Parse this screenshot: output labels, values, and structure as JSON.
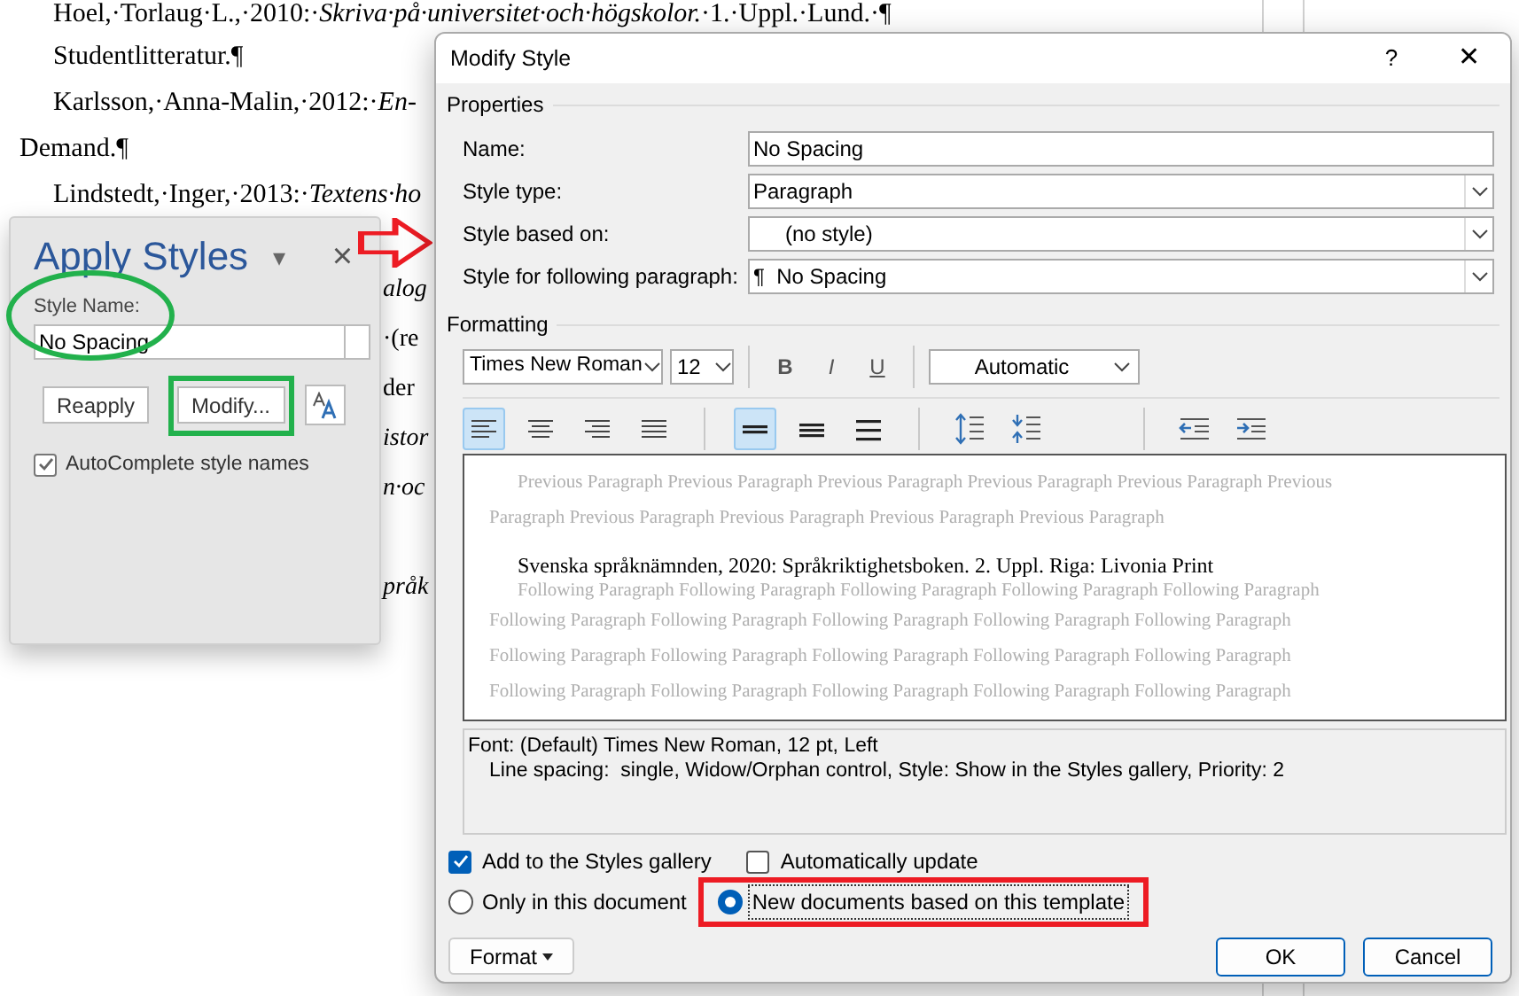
{
  "document": {
    "lines": [
      {
        "text": "Hoel,·Torlaug·L.,·2010:·*Skriva·på·universitet·och·högskolor.*·1.·Uppl.·Lund.·¶",
        "kind": "indented"
      },
      {
        "text": "Studentlitteratur.¶",
        "kind": "indented"
      },
      {
        "text": "Karlsson,·Anna-Malin,·2012:·*En-*",
        "kind": "indented"
      },
      {
        "text": "Demand.¶",
        "kind": "flush"
      },
      {
        "text": "Lindstedt,·Inger,·2013:·*Textens·ho*",
        "kind": "indented"
      },
      {
        "kind": "blank"
      },
      {
        "text": "*alog*",
        "kind": "fragment"
      },
      {
        "text": "·(re",
        "kind": "fragment"
      },
      {
        "text": "der",
        "kind": "fragment"
      },
      {
        "text": "*istor*",
        "kind": "fragment"
      },
      {
        "text": "*n·oc*",
        "kind": "fragment"
      },
      {
        "kind": "blank"
      },
      {
        "text": "*pråk*",
        "kind": "fragment"
      }
    ]
  },
  "apply_styles": {
    "title": "Apply Styles",
    "menu": "▾",
    "close": "×",
    "style_name_label": "Style Name:",
    "style_name_value": "No Spacing",
    "buttons": [
      {
        "label": "Reapply",
        "highlighted": false
      },
      {
        "label": "Modify...",
        "highlighted": true
      }
    ],
    "autocomplete": {
      "label": "AutoComplete style names",
      "checked": true
    }
  },
  "dialog": {
    "title": "Modify Style",
    "help": "?",
    "close": "✕",
    "properties": {
      "heading": "Properties",
      "fields": [
        {
          "label": "Name:",
          "value": "No Spacing",
          "kind": "text"
        },
        {
          "label": "Style type:",
          "value": "Paragraph",
          "kind": "dropdown"
        },
        {
          "label": "Style based on:",
          "value": "(no style)",
          "kind": "dropdown"
        },
        {
          "label": "Style for following paragraph:",
          "value": "¶  No Spacing",
          "kind": "dropdown"
        }
      ]
    },
    "formatting": {
      "heading": "Formatting",
      "font": "Times New Roman",
      "size": "12",
      "bold": "B",
      "italic": "I",
      "underline": "U",
      "font_colour": "Automatic",
      "alignment": [
        {
          "kind": "left",
          "selected": true
        },
        {
          "kind": "center",
          "selected": false
        },
        {
          "kind": "right",
          "selected": false
        },
        {
          "kind": "justify",
          "selected": false
        }
      ],
      "spacing": [
        {
          "kind": "single",
          "selected": true
        },
        {
          "kind": "onehalf",
          "selected": false
        },
        {
          "kind": "double",
          "selected": false
        }
      ],
      "paragraph_spacing": [
        {
          "kind": "increase"
        },
        {
          "kind": "decrease"
        }
      ],
      "indent": [
        {
          "kind": "outdent"
        },
        {
          "kind": "indent"
        }
      ]
    },
    "preview": {
      "previous": [
        "Previous Paragraph Previous Paragraph Previous Paragraph Previous Paragraph Previous Paragraph Previous",
        "Paragraph Previous Paragraph Previous Paragraph Previous Paragraph Previous Paragraph"
      ],
      "sample": "Svenska språknämnden, 2020: Språkriktighetsboken. 2. Uppl. Riga: Livonia Print",
      "following": [
        "Following Paragraph Following Paragraph Following Paragraph Following Paragraph Following Paragraph",
        "Following Paragraph Following Paragraph Following Paragraph Following Paragraph Following Paragraph",
        "Following Paragraph Following Paragraph Following Paragraph Following Paragraph Following Paragraph",
        "Following Paragraph Following Paragraph Following Paragraph Following Paragraph Following Paragraph"
      ]
    },
    "description": [
      "Font: (Default) Times New Roman, 12 pt, Left",
      "Line spacing:  single, Widow/Orphan control, Style: Show in the Styles gallery, Priority: 2"
    ],
    "add_to_gallery": {
      "label": "Add to the Styles gallery",
      "checked": true
    },
    "auto_update": {
      "label": "Automatically update",
      "checked": false
    },
    "scope": [
      {
        "label": "Only in this document",
        "selected": false,
        "highlighted": false
      },
      {
        "label": "New documents based on this template",
        "selected": true,
        "highlighted": true
      }
    ],
    "format_button": "Format",
    "ok": "OK",
    "cancel": "Cancel"
  }
}
